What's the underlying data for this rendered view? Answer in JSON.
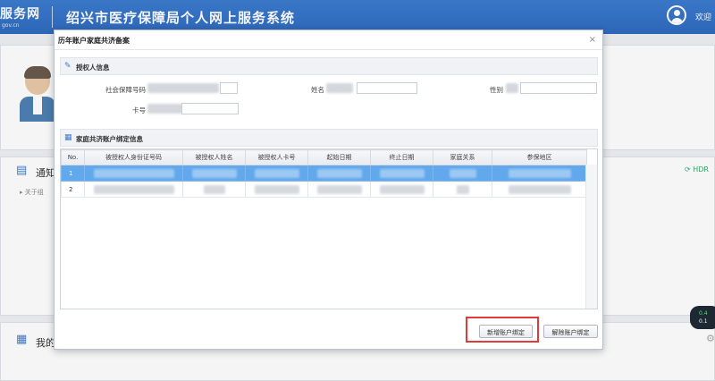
{
  "header": {
    "logo_main": "服务网",
    "logo_sub": "gov.cn",
    "title": "绍兴市医疗保障局个人网上服务系统",
    "welcome": "欢迎"
  },
  "background": {
    "notice_label": "通知",
    "notice_item": "关于组",
    "refresh_label": "HDR",
    "my_label": "我的",
    "rate_up": "0.4",
    "rate_down": "0.1"
  },
  "dialog": {
    "title": "历年账户家庭共济备案",
    "close": "×",
    "authorizer_section": {
      "title": "授权人信息",
      "ssn_label": "社会保障号码",
      "name_label": "姓名",
      "gender_label": "性别",
      "card_label": "卡号"
    },
    "binding_section": {
      "title": "家庭共济账户绑定信息",
      "columns": [
        "No.",
        "被授权人身份证号码",
        "被授权人姓名",
        "被授权人卡号",
        "起始日期",
        "终止日期",
        "家庭关系",
        "参保地区"
      ],
      "rows": [
        {
          "no": "1",
          "selected": true
        },
        {
          "no": "2",
          "selected": false
        }
      ]
    },
    "buttons": {
      "add_binding": "新增账户绑定",
      "remove_binding": "解除账户绑定"
    }
  }
}
